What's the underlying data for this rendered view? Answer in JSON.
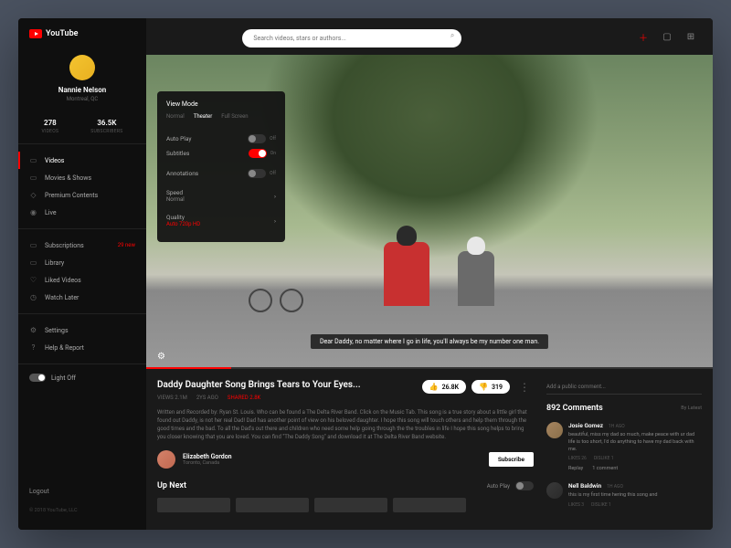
{
  "brand": "YouTube",
  "profile": {
    "name": "Nannie Nelson",
    "location": "Montreal, QC"
  },
  "stats": {
    "videos": {
      "value": "278",
      "label": "VIDEOS"
    },
    "subs": {
      "value": "36.5K",
      "label": "SUBSCRIBERS"
    }
  },
  "nav": {
    "primary": [
      "Videos",
      "Movies & Shows",
      "Premium Contents",
      "Live"
    ],
    "secondary": {
      "subscriptions": "Subscriptions",
      "subscriptions_badge": "29 new",
      "library": "Library",
      "liked": "Liked Videos",
      "watch_later": "Watch Later"
    },
    "tertiary": [
      "Settings",
      "Help & Report"
    ]
  },
  "light_off": "Light Off",
  "logout": "Logout",
  "copyright": "© 2018 YouTube, LLC",
  "search": {
    "placeholder": "Search videos, stars or authors..."
  },
  "settings_panel": {
    "title": "View Mode",
    "modes": [
      "Normal",
      "Theater",
      "Full Screen"
    ],
    "autoplay": "Auto Play",
    "autoplay_state": "Off",
    "subtitles": "Subtitles",
    "subtitles_state": "On",
    "annotations": "Annotations",
    "annotations_state": "Off",
    "speed": "Speed",
    "speed_value": "Normal",
    "quality": "Quality",
    "quality_value": "Auto 720p HD"
  },
  "caption": "Dear Daddy, no matter where I go in life, you'll always be my number one man.",
  "video": {
    "title": "Daddy Daughter Song Brings Tears to Your Eyes...",
    "views": "VIEWS 2.1M",
    "age": "2YS AGO",
    "shared": "SHARED 2.8K",
    "likes": "26.8K",
    "dislikes": "319",
    "description": "Written and Recorded by: Ryan St. Louis. Who can be found a The Delta River Band. Click on the Music Tab. This song is a true story about a little girl that found out Daddy, is not her real Dad! Dad has another point of view on his beloved daughter. I hope this song will touch others and help them through the good times and the bad. To all the Dad's out there and children who need some help going through the the troubles in life I hope this song helps to bring you closer knowing that you are loved. You can find \"The Daddy Song\" and download it at The Delta River Band website.",
    "uploader": {
      "name": "Elizabeth Gordon",
      "location": "Toronto, Canada"
    },
    "subscribe": "Subscribe"
  },
  "upnext": {
    "title": "Up Next",
    "autoplay": "Auto Play"
  },
  "comments": {
    "input_placeholder": "Add a public comment...",
    "count": "892 Comments",
    "sort": "By Latest",
    "items": [
      {
        "author": "Josie Gomez",
        "time": "1H AGO",
        "text": "beautiful, miss my dad so much, make peace with ur dad life is too short, I'd do anything to have my dad back with me.",
        "likes": "LIKES 26",
        "dislikes": "DISLIKE 1",
        "replay": "Replay",
        "reply_count": "1 comment"
      },
      {
        "author": "Nell Baldwin",
        "time": "1H AGO",
        "text": "this is my first time hering this song and",
        "likes": "LIKES 3",
        "dislikes": "DISLIKE 1"
      }
    ]
  }
}
